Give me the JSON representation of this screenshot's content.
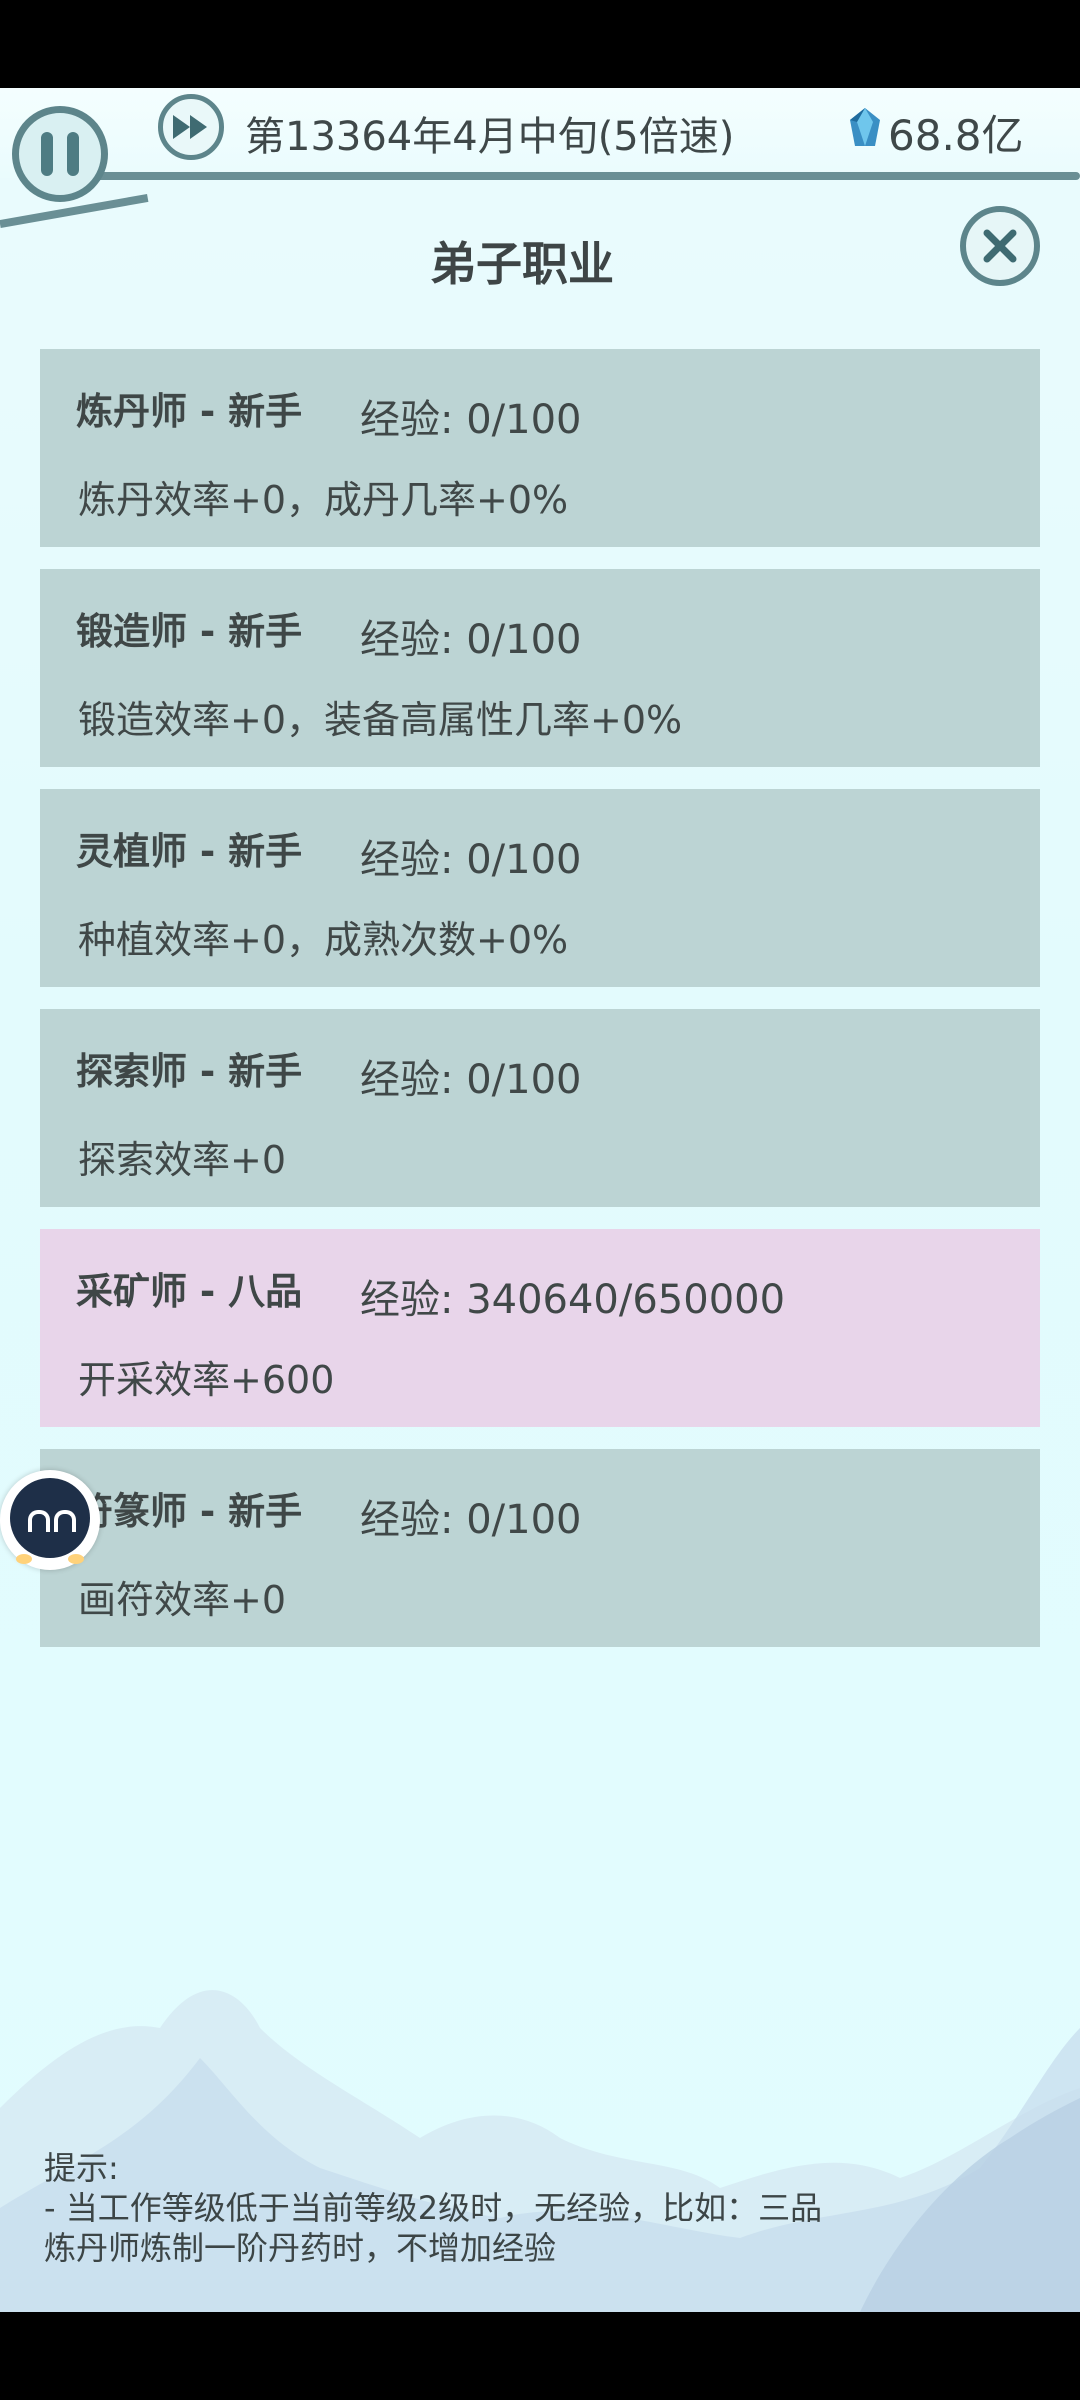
{
  "header": {
    "date": "第13364年4月中旬(5倍速)",
    "spirit_stones": "68.8亿"
  },
  "title": "弟子职业",
  "professions": [
    {
      "name": "炼丹师 - 新手",
      "exp": "经验: 0/100",
      "effect": "炼丹效率+0，成丹几率+0%"
    },
    {
      "name": "锻造师 - 新手",
      "exp": "经验: 0/100",
      "effect": "锻造效率+0，装备高属性几率+0%"
    },
    {
      "name": "灵植师 - 新手",
      "exp": "经验: 0/100",
      "effect": "种植效率+0，成熟次数+0%"
    },
    {
      "name": "探索师 - 新手",
      "exp": "经验: 0/100",
      "effect": "探索效率+0"
    },
    {
      "name": "采矿师 - 八品",
      "exp": "经验: 340640/650000",
      "effect": "开采效率+600"
    },
    {
      "name": "符篆师 - 新手",
      "exp": "经验: 0/100",
      "effect": "画符效率+0"
    }
  ],
  "tips": {
    "heading": "提示:",
    "line1": "- 当工作等级低于当前等级2级时，无经验，比如：三品",
    "line2": "炼丹师炼制一阶丹药时，不增加经验"
  },
  "colors": {
    "card_default": "#bcd4d4",
    "card_highlight": "#e8d5ea",
    "background": "#e3fbfd",
    "frame_accent": "#5d858b"
  }
}
